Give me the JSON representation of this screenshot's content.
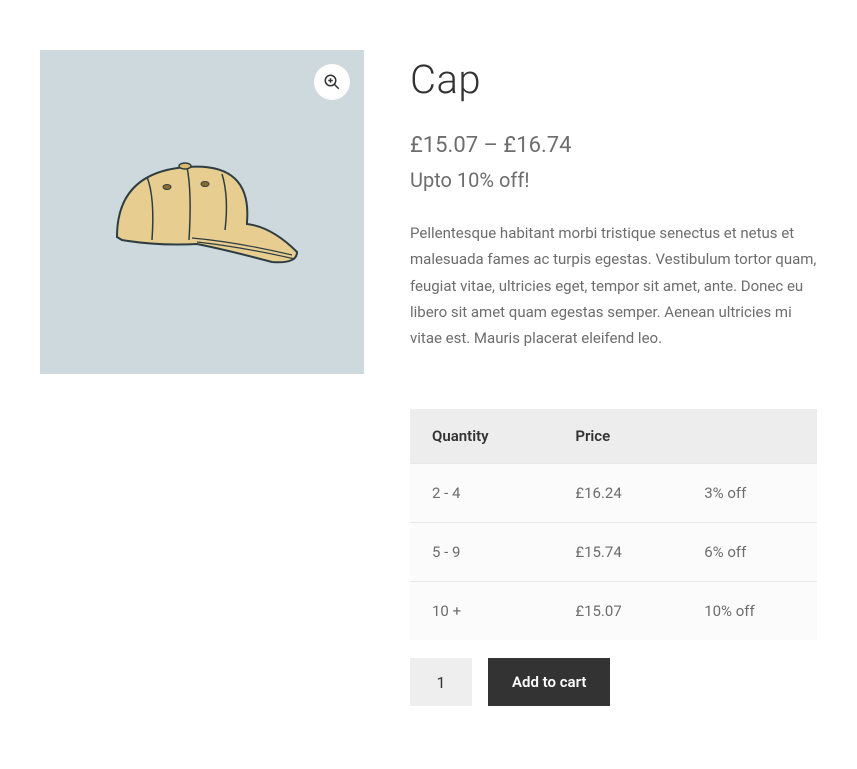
{
  "product": {
    "title": "Cap",
    "price_low": "£15.07",
    "price_sep": " – ",
    "price_high": "£16.74",
    "discount_headline": "Upto 10% off!",
    "description": "Pellentesque habitant morbi tristique senectus et netus et malesuada fames ac turpis egestas. Vestibulum tortor quam, feugiat vitae, ultricies eget, tempor sit amet, ante. Donec eu libero sit amet quam egestas semper. Aenean ultricies mi vitae est. Mauris placerat eleifend leo."
  },
  "pricing_table": {
    "headers": {
      "qty": "Quantity",
      "price": "Price",
      "discount": ""
    },
    "rows": [
      {
        "qty": "2 - 4",
        "price": "£16.24",
        "discount": "3% off"
      },
      {
        "qty": "5 - 9",
        "price": "£15.74",
        "discount": "6% off"
      },
      {
        "qty": "10 +",
        "price": "£15.07",
        "discount": "10% off"
      }
    ]
  },
  "cart": {
    "quantity_value": "1",
    "add_label": "Add to cart"
  },
  "icons": {
    "zoom": "zoom-in-icon"
  }
}
